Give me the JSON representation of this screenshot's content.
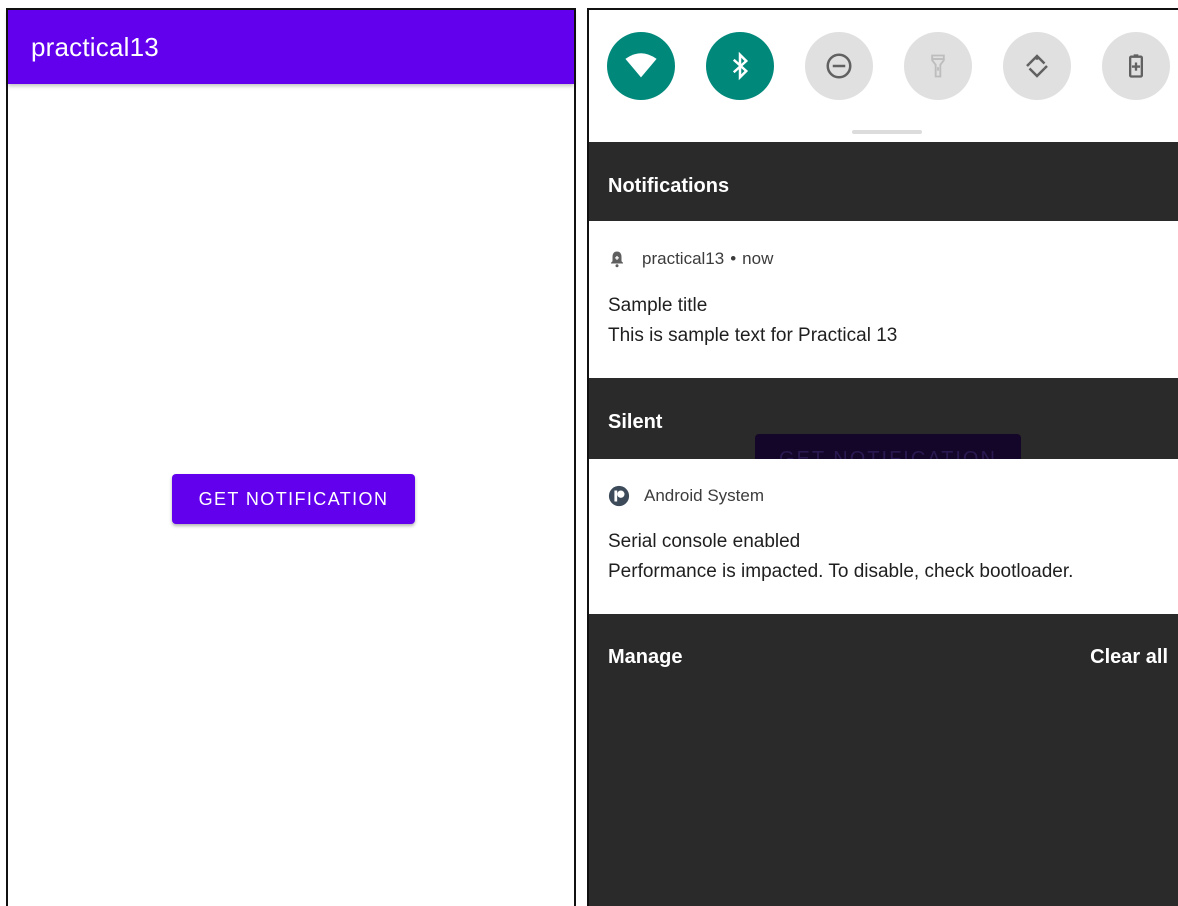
{
  "left_app": {
    "title": "practical13",
    "button_label": "GET NOTIFICATION",
    "accent": "#6200ee"
  },
  "quick_settings": {
    "tiles": [
      {
        "icon": "wifi-icon",
        "active": true
      },
      {
        "icon": "bluetooth-icon",
        "active": true
      },
      {
        "icon": "do-not-disturb-icon",
        "active": false
      },
      {
        "icon": "flashlight-icon",
        "active": false
      },
      {
        "icon": "auto-rotate-icon",
        "active": false
      },
      {
        "icon": "battery-saver-icon",
        "active": false
      }
    ],
    "active_color": "#00897b"
  },
  "shade": {
    "notifications_header": "Notifications",
    "silent_header": "Silent",
    "ghost_button_label": "GET NOTIFICATION",
    "manage_label": "Manage",
    "clear_all_label": "Clear all",
    "background": "#2a2a2a"
  },
  "notifications": [
    {
      "icon": "notification-bell-icon",
      "app": "practical13",
      "time": "now",
      "title": "Sample title",
      "text": "This is sample text for Practical 13"
    },
    {
      "icon": "android-system-icon",
      "app": "Android System",
      "title": "Serial console enabled",
      "text": "Performance is impacted. To disable, check bootloader."
    }
  ]
}
